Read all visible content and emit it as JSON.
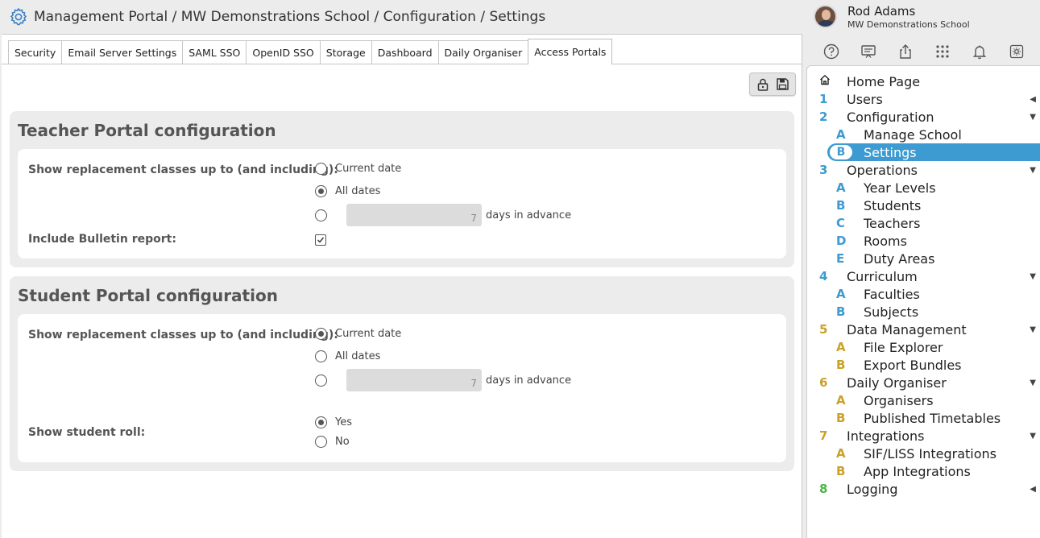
{
  "header": {
    "breadcrumb": "Management Portal / MW Demonstrations School / Configuration / Settings"
  },
  "tabs": [
    {
      "label": "Security"
    },
    {
      "label": "Email Server Settings"
    },
    {
      "label": "SAML SSO"
    },
    {
      "label": "OpenID SSO"
    },
    {
      "label": "Storage"
    },
    {
      "label": "Dashboard"
    },
    {
      "label": "Daily Organiser"
    },
    {
      "label": "Access Portals",
      "active": true
    }
  ],
  "teacher": {
    "title": "Teacher Portal configuration",
    "replacement_label": "Show replacement classes up to (and including):",
    "opt_current": "Current date",
    "opt_all": "All dates",
    "days_value": "7",
    "days_suffix": "days in advance",
    "selected": "All dates",
    "bulletin_label": "Include Bulletin report:",
    "bulletin_checked": true
  },
  "student": {
    "title": "Student Portal configuration",
    "replacement_label": "Show replacement classes up to (and including):",
    "opt_current": "Current date",
    "opt_all": "All dates",
    "days_value": "7",
    "days_suffix": "days in advance",
    "selected": "Current date",
    "roll_label": "Show student roll:",
    "roll_yes": "Yes",
    "roll_no": "No",
    "roll_selected": "Yes"
  },
  "user": {
    "name": "Rod Adams",
    "school": "MW Demonstrations School"
  },
  "icons": [
    "help-icon",
    "presentation-icon",
    "share-icon",
    "apps-grid-icon",
    "bell-icon",
    "settings-icon"
  ],
  "nav": {
    "home": "Home Page",
    "users": {
      "num": "1",
      "label": "Users"
    },
    "configuration": {
      "num": "2",
      "label": "Configuration"
    },
    "manage_school": {
      "num": "A",
      "label": "Manage School"
    },
    "settings": {
      "num": "B",
      "label": "Settings"
    },
    "operations": {
      "num": "3",
      "label": "Operations"
    },
    "year_levels": {
      "num": "A",
      "label": "Year Levels"
    },
    "students": {
      "num": "B",
      "label": "Students"
    },
    "teachers": {
      "num": "C",
      "label": "Teachers"
    },
    "rooms": {
      "num": "D",
      "label": "Rooms"
    },
    "duty_areas": {
      "num": "E",
      "label": "Duty Areas"
    },
    "curriculum": {
      "num": "4",
      "label": "Curriculum"
    },
    "faculties": {
      "num": "A",
      "label": "Faculties"
    },
    "subjects": {
      "num": "B",
      "label": "Subjects"
    },
    "data_management": {
      "num": "5",
      "label": "Data Management"
    },
    "file_explorer": {
      "num": "A",
      "label": "File Explorer"
    },
    "export_bundles": {
      "num": "B",
      "label": "Export Bundles"
    },
    "daily_organiser": {
      "num": "6",
      "label": "Daily Organiser"
    },
    "organisers": {
      "num": "A",
      "label": "Organisers"
    },
    "published_timetables": {
      "num": "B",
      "label": "Published Timetables"
    },
    "integrations": {
      "num": "7",
      "label": "Integrations"
    },
    "sif_liss": {
      "num": "A",
      "label": "SIF/LISS Integrations"
    },
    "app_integrations": {
      "num": "B",
      "label": "App Integrations"
    },
    "logging": {
      "num": "8",
      "label": "Logging"
    }
  },
  "colors": {
    "accent_blue": "#3d9bd1",
    "accent_gold": "#c9a227",
    "accent_green": "#4bb54b"
  }
}
